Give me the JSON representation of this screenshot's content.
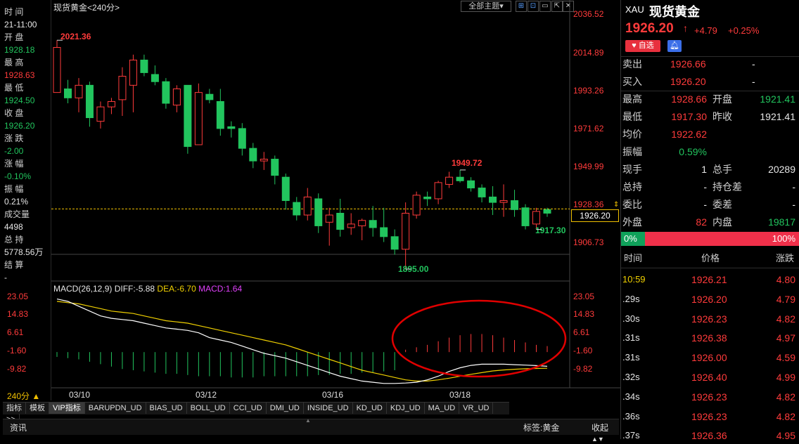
{
  "chart": {
    "title": "现货黄金",
    "period_tag": "<240分>",
    "theme_button": "全部主题",
    "price_ticks": [
      "2036.52",
      "2014.89",
      "1993.26",
      "1971.62",
      "1949.99",
      "1928.36",
      "1906.73"
    ],
    "current_price_box": "1926.20",
    "annotations": {
      "high": "2021.36",
      "mid_high": "1949.72",
      "low": "1895.00",
      "recent_low": "1917.30"
    },
    "macd_header": {
      "title": "MACD(26,12,9)",
      "diff": "DIFF:-5.88",
      "dea": "DEA:-6.70",
      "macd": "MACD:1.64"
    },
    "macd_ticks": [
      "23.05",
      "14.83",
      "6.61",
      "-1.60",
      "-9.82"
    ],
    "date_labels": [
      "03/10",
      "03/12",
      "03/16",
      "03/18"
    ],
    "period_label": "240分 ▲",
    "colors": {
      "up": "#ff3b3b",
      "down": "#22c55e",
      "diff": "#ffffff",
      "dea": "#f0d000",
      "macd": "#e040fb",
      "annot": "#e00000"
    }
  },
  "left_info": [
    {
      "label": "时 间",
      "value": "21-11:00",
      "vclass": "white"
    },
    {
      "label": "开 盘",
      "value": "1928.18",
      "vclass": "green"
    },
    {
      "label": "最 高",
      "value": "1928.63",
      "vclass": "red"
    },
    {
      "label": "最 低",
      "value": "1924.50",
      "vclass": "green"
    },
    {
      "label": "收 盘",
      "value": "1926.20",
      "vclass": "green"
    },
    {
      "label": "涨 跌",
      "value": "-2.00",
      "vclass": "green"
    },
    {
      "label": "涨 幅",
      "value": "-0.10%",
      "vclass": "green"
    },
    {
      "label": "振 幅",
      "value": "0.21%",
      "vclass": "white"
    },
    {
      "label": "成交量",
      "value": "4498",
      "vclass": "white"
    },
    {
      "label": "总 持",
      "value": "5778.56万",
      "vclass": "white"
    },
    {
      "label": "结 算",
      "value": "-",
      "vclass": "white"
    }
  ],
  "tabs": [
    "指标",
    "模板",
    "VIP指标",
    "BARUPDN_UD",
    "BIAS_UD",
    "BOLL_UD",
    "CCI_UD",
    "DMI_UD",
    "INSIDE_UD",
    "KD_UD",
    "KDJ_UD",
    "MA_UD",
    "VR_UD",
    ">>"
  ],
  "news_bar": {
    "left": "资讯",
    "tag": "标签:黄金",
    "collapse": "收起"
  },
  "right": {
    "symbol": "XAU",
    "name": "现货黄金",
    "price": "1926.20",
    "arrow": "↑",
    "change": "+4.79",
    "pct": "+0.25%",
    "fav_label": "自选",
    "sell": {
      "label": "卖出",
      "value": "1926.66",
      "extra": "-"
    },
    "buy": {
      "label": "买入",
      "value": "1926.20",
      "extra": "-"
    },
    "stats": [
      {
        "l1": "最高",
        "v1": "1928.66",
        "c1": "red",
        "l2": "开盘",
        "v2": "1921.41",
        "c2": "green"
      },
      {
        "l1": "最低",
        "v1": "1917.30",
        "c1": "red",
        "l2": "昨收",
        "v2": "1921.41",
        "c2": "white"
      },
      {
        "l1": "均价",
        "v1": "1922.62",
        "c1": "red",
        "l2": "",
        "v2": "",
        "c2": "white"
      },
      {
        "l1": "振幅",
        "v1": "0.59%",
        "c1": "green",
        "l2": "",
        "v2": "",
        "c2": "white"
      },
      {
        "l1": "现手",
        "v1": "1",
        "c1": "white",
        "l2": "总手",
        "v2": "20289",
        "c2": "white"
      },
      {
        "l1": "总持",
        "v1": "-",
        "c1": "white",
        "l2": "持仓差",
        "v2": "-",
        "c2": "white"
      },
      {
        "l1": "委比",
        "v1": "-",
        "c1": "white",
        "l2": "委差",
        "v2": "-",
        "c2": "white"
      },
      {
        "l1": "外盘",
        "v1": "82",
        "c1": "red",
        "l2": "内盘",
        "v2": "19817",
        "c2": "green"
      }
    ],
    "bar_left": "0%",
    "bar_right": "100%",
    "tick_headers": [
      "时间",
      "价格",
      "涨跌"
    ],
    "ticks": [
      {
        "t": "10:59",
        "p": "1926.21",
        "c": "4.80",
        "tc": "yellow"
      },
      {
        "t": ".29s",
        "p": "1926.20",
        "c": "4.79",
        "tc": "white"
      },
      {
        "t": ".30s",
        "p": "1926.23",
        "c": "4.82",
        "tc": "white"
      },
      {
        "t": ".31s",
        "p": "1926.38",
        "c": "4.97",
        "tc": "white"
      },
      {
        "t": ".31s",
        "p": "1926.00",
        "c": "4.59",
        "tc": "white"
      },
      {
        "t": ".32s",
        "p": "1926.40",
        "c": "4.99",
        "tc": "white"
      },
      {
        "t": ".34s",
        "p": "1926.23",
        "c": "4.82",
        "tc": "white"
      },
      {
        "t": ".36s",
        "p": "1926.23",
        "c": "4.82",
        "tc": "white"
      },
      {
        "t": ".37s",
        "p": "1926.36",
        "c": "4.95",
        "tc": "white"
      }
    ]
  },
  "chart_data": {
    "type": "candlestick",
    "price_axis": {
      "min": 1895.0,
      "max": 2036.52,
      "ticks": [
        2036.52,
        2014.89,
        1993.26,
        1971.62,
        1949.99,
        1928.36,
        1906.73
      ]
    },
    "candles": [
      {
        "o": 1993,
        "h": 2022,
        "l": 1993,
        "c": 2018
      },
      {
        "o": 1995,
        "h": 2000,
        "l": 1987,
        "c": 1990
      },
      {
        "o": 1990,
        "h": 2001,
        "l": 1982,
        "c": 1997
      },
      {
        "o": 1997,
        "h": 1999,
        "l": 1974,
        "c": 1979
      },
      {
        "o": 1977,
        "h": 1988,
        "l": 1973,
        "c": 1985
      },
      {
        "o": 1985,
        "h": 1990,
        "l": 1981,
        "c": 1988
      },
      {
        "o": 1989,
        "h": 2007,
        "l": 1980,
        "c": 2002
      },
      {
        "o": 1997,
        "h": 2014,
        "l": 1982,
        "c": 2011
      },
      {
        "o": 2011,
        "h": 2014,
        "l": 2002,
        "c": 2004
      },
      {
        "o": 2003,
        "h": 2008,
        "l": 1997,
        "c": 1999
      },
      {
        "o": 1999,
        "h": 2001,
        "l": 1984,
        "c": 1987
      },
      {
        "o": 1986,
        "h": 1997,
        "l": 1982,
        "c": 1995
      },
      {
        "o": 1997,
        "h": 1997,
        "l": 1959,
        "c": 1963
      },
      {
        "o": 1964,
        "h": 1998,
        "l": 1964,
        "c": 1993
      },
      {
        "o": 1992,
        "h": 1995,
        "l": 1987,
        "c": 1989
      },
      {
        "o": 1988,
        "h": 1995,
        "l": 1969,
        "c": 1973
      },
      {
        "o": 1974,
        "h": 1977,
        "l": 1968,
        "c": 1973
      },
      {
        "o": 1973,
        "h": 1976,
        "l": 1958,
        "c": 1962
      },
      {
        "o": 1962,
        "h": 1965,
        "l": 1951,
        "c": 1955
      },
      {
        "o": 1955,
        "h": 1960,
        "l": 1950,
        "c": 1956
      },
      {
        "o": 1956,
        "h": 1958,
        "l": 1942,
        "c": 1947
      },
      {
        "o": 1946,
        "h": 1948,
        "l": 1928,
        "c": 1933
      },
      {
        "o": 1932,
        "h": 1935,
        "l": 1922,
        "c": 1925
      },
      {
        "o": 1925,
        "h": 1940,
        "l": 1922,
        "c": 1935
      },
      {
        "o": 1934,
        "h": 1937,
        "l": 1915,
        "c": 1919
      },
      {
        "o": 1921,
        "h": 1929,
        "l": 1908,
        "c": 1925
      },
      {
        "o": 1926,
        "h": 1934,
        "l": 1913,
        "c": 1917
      },
      {
        "o": 1918,
        "h": 1926,
        "l": 1914,
        "c": 1920
      },
      {
        "o": 1919,
        "h": 1923,
        "l": 1911,
        "c": 1922
      },
      {
        "o": 1922,
        "h": 1930,
        "l": 1913,
        "c": 1918
      },
      {
        "o": 1918,
        "h": 1929,
        "l": 1910,
        "c": 1913
      },
      {
        "o": 1913,
        "h": 1917,
        "l": 1903,
        "c": 1906
      },
      {
        "o": 1906,
        "h": 1932,
        "l": 1895,
        "c": 1926
      },
      {
        "o": 1925,
        "h": 1938,
        "l": 1923,
        "c": 1936
      },
      {
        "o": 1935,
        "h": 1938,
        "l": 1930,
        "c": 1934
      },
      {
        "o": 1934,
        "h": 1944,
        "l": 1931,
        "c": 1943
      },
      {
        "o": 1942,
        "h": 1949,
        "l": 1940,
        "c": 1946
      },
      {
        "o": 1946,
        "h": 1950,
        "l": 1943,
        "c": 1944
      },
      {
        "o": 1944,
        "h": 1946,
        "l": 1938,
        "c": 1940
      },
      {
        "o": 1940,
        "h": 1942,
        "l": 1932,
        "c": 1935
      },
      {
        "o": 1935,
        "h": 1941,
        "l": 1925,
        "c": 1932
      },
      {
        "o": 1932,
        "h": 1942,
        "l": 1924,
        "c": 1933
      },
      {
        "o": 1933,
        "h": 1939,
        "l": 1924,
        "c": 1928
      },
      {
        "o": 1929,
        "h": 1931,
        "l": 1917,
        "c": 1919
      },
      {
        "o": 1920,
        "h": 1929,
        "l": 1917,
        "c": 1927
      },
      {
        "o": 1928,
        "h": 1929,
        "l": 1924,
        "c": 1926
      }
    ],
    "macd": {
      "axis": {
        "min": -14.5,
        "max": 23.05
      },
      "hist": [
        -2,
        -2.5,
        -3,
        -4,
        -5,
        -6,
        -7,
        -7.5,
        -8,
        -8.5,
        -9,
        -9,
        -9.5,
        -10,
        -10,
        -10,
        -10.5,
        -10.5,
        -10.5,
        -10,
        -10,
        -10,
        -10,
        -10,
        -9.5,
        -9.5,
        -9,
        -9,
        -8.5,
        -8.5,
        -8,
        -7.5,
        1,
        2,
        3,
        4.5,
        6,
        7,
        7.5,
        7.5,
        7,
        6,
        5,
        4,
        3,
        2.5
      ],
      "diff": [
        22,
        21,
        19,
        17,
        15,
        14,
        13.5,
        13,
        12,
        11,
        10,
        9.5,
        9,
        8,
        6,
        5,
        4,
        2.5,
        1,
        -0.5,
        -1.5,
        -2.5,
        -4,
        -5.5,
        -7,
        -8.5,
        -10,
        -11,
        -12,
        -12.5,
        -13,
        -13,
        -12.8,
        -12.5,
        -11.5,
        -10,
        -8,
        -6.5,
        -5.5,
        -5,
        -5,
        -5,
        -5.2,
        -5.4,
        -5.6,
        -5.88
      ],
      "dea": [
        21,
        20.5,
        20,
        19,
        18,
        17,
        16.5,
        16,
        15,
        14,
        13,
        12.5,
        12,
        11,
        10,
        9,
        8,
        7,
        6,
        5,
        4,
        3,
        1.5,
        0,
        -1.5,
        -3,
        -4.5,
        -6,
        -7.5,
        -8.5,
        -9.5,
        -10.5,
        -11.5,
        -12,
        -12,
        -11.5,
        -10.8,
        -10,
        -9.2,
        -8.5,
        -7.8,
        -7.4,
        -7.1,
        -6.9,
        -6.8,
        -6.7
      ]
    },
    "reference_price": 1928.36
  }
}
